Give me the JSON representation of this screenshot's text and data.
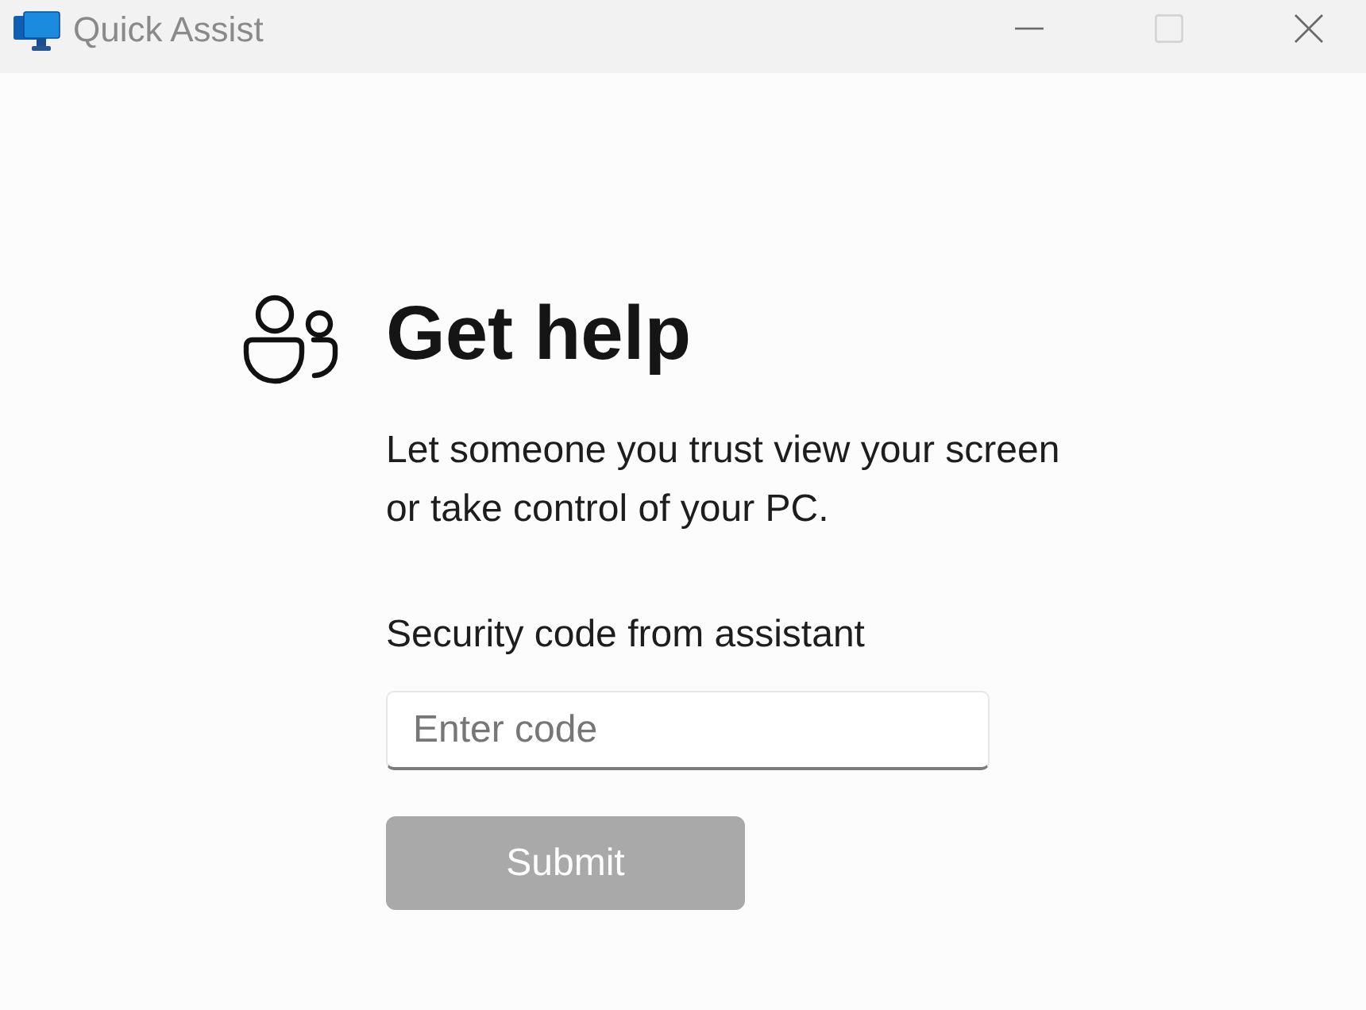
{
  "window": {
    "title": "Quick Assist",
    "controls": [
      {
        "kind": "minimize",
        "disabled": false
      },
      {
        "kind": "maximize",
        "disabled": true
      },
      {
        "kind": "close",
        "disabled": false
      }
    ]
  },
  "heading": "Get help",
  "description": "Let someone you trust view your screen or take control of your PC.",
  "code_field": {
    "label": "Security code from assistant",
    "placeholder": "Enter code"
  },
  "submit_button": {
    "label": "Submit",
    "disabled": true
  }
}
